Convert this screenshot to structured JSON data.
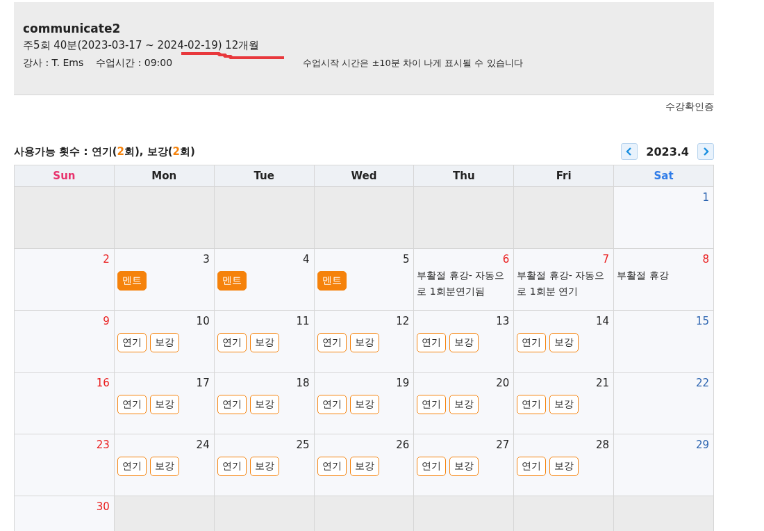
{
  "course": {
    "title": "communicate2",
    "schedule": "주5회 40분(2023-03-17 ~ 2024-02-19) 12개월",
    "teacher": "강사 : T. Ems",
    "time": "수업시간 : 09:00",
    "notice": "수업시작 시간은 ±10분 차이 나게 표시될 수 있습니다"
  },
  "certificate_link": "수강확인증",
  "usage": "사용가능 횟수 : 연기(**2**회), 보강(**2**회)",
  "month": "2023.4",
  "weekdays": [
    {
      "label": "Sun",
      "color": "#e8336d"
    },
    {
      "label": "Mon",
      "color": "#222222"
    },
    {
      "label": "Tue",
      "color": "#222222"
    },
    {
      "label": "Wed",
      "color": "#222222"
    },
    {
      "label": "Thu",
      "color": "#222222"
    },
    {
      "label": "Fri",
      "color": "#222222"
    },
    {
      "label": "Sat",
      "color": "#2f7ce8"
    }
  ],
  "weeks": [
    [
      {
        "kind": "blank"
      },
      {
        "kind": "blank"
      },
      {
        "kind": "blank"
      },
      {
        "kind": "blank"
      },
      {
        "kind": "blank"
      },
      {
        "kind": "blank"
      },
      {
        "kind": "day",
        "day": "1",
        "color": "#2c64b0"
      }
    ],
    [
      {
        "kind": "day",
        "day": "2",
        "color": "#ea1c1c"
      },
      {
        "kind": "day",
        "day": "3",
        "color": "#222222",
        "items": [
          {
            "kind": "filled",
            "text": "멘트"
          }
        ]
      },
      {
        "kind": "day",
        "day": "4",
        "color": "#222222",
        "items": [
          {
            "kind": "filled",
            "text": "멘트"
          }
        ]
      },
      {
        "kind": "day",
        "day": "5",
        "color": "#222222",
        "items": [
          {
            "kind": "filled",
            "text": "멘트"
          }
        ]
      },
      {
        "kind": "day",
        "day": "6",
        "color": "#ea1c1c",
        "items": [
          {
            "kind": "note",
            "text": "부활절 휴강- 자동으로 1회분연기됨"
          }
        ]
      },
      {
        "kind": "day",
        "day": "7",
        "color": "#ea1c1c",
        "items": [
          {
            "kind": "note",
            "text": "부활절 휴강- 자동으로 1회분 연기"
          }
        ]
      },
      {
        "kind": "day",
        "day": "8",
        "color": "#ea1c1c",
        "items": [
          {
            "kind": "note",
            "text": "부활절 휴강"
          }
        ]
      }
    ],
    [
      {
        "kind": "day",
        "day": "9",
        "color": "#ea1c1c"
      },
      {
        "kind": "day",
        "day": "10",
        "color": "#222222",
        "items": [
          {
            "kind": "outline",
            "text": "연기"
          },
          {
            "kind": "outline",
            "text": "보강"
          }
        ]
      },
      {
        "kind": "day",
        "day": "11",
        "color": "#222222",
        "items": [
          {
            "kind": "outline",
            "text": "연기"
          },
          {
            "kind": "outline",
            "text": "보강"
          }
        ]
      },
      {
        "kind": "day",
        "day": "12",
        "color": "#222222",
        "items": [
          {
            "kind": "outline",
            "text": "연기"
          },
          {
            "kind": "outline",
            "text": "보강"
          }
        ]
      },
      {
        "kind": "day",
        "day": "13",
        "color": "#222222",
        "items": [
          {
            "kind": "outline",
            "text": "연기"
          },
          {
            "kind": "outline",
            "text": "보강"
          }
        ]
      },
      {
        "kind": "day",
        "day": "14",
        "color": "#222222",
        "items": [
          {
            "kind": "outline",
            "text": "연기"
          },
          {
            "kind": "outline",
            "text": "보강"
          }
        ]
      },
      {
        "kind": "day",
        "day": "15",
        "color": "#2c64b0"
      }
    ],
    [
      {
        "kind": "day",
        "day": "16",
        "color": "#ea1c1c"
      },
      {
        "kind": "day",
        "day": "17",
        "color": "#222222",
        "items": [
          {
            "kind": "outline",
            "text": "연기"
          },
          {
            "kind": "outline",
            "text": "보강"
          }
        ]
      },
      {
        "kind": "day",
        "day": "18",
        "color": "#222222",
        "items": [
          {
            "kind": "outline",
            "text": "연기"
          },
          {
            "kind": "outline",
            "text": "보강"
          }
        ]
      },
      {
        "kind": "day",
        "day": "19",
        "color": "#222222",
        "items": [
          {
            "kind": "outline",
            "text": "연기"
          },
          {
            "kind": "outline",
            "text": "보강"
          }
        ]
      },
      {
        "kind": "day",
        "day": "20",
        "color": "#222222",
        "items": [
          {
            "kind": "outline",
            "text": "연기"
          },
          {
            "kind": "outline",
            "text": "보강"
          }
        ]
      },
      {
        "kind": "day",
        "day": "21",
        "color": "#222222",
        "items": [
          {
            "kind": "outline",
            "text": "연기"
          },
          {
            "kind": "outline",
            "text": "보강"
          }
        ]
      },
      {
        "kind": "day",
        "day": "22",
        "color": "#2c64b0"
      }
    ],
    [
      {
        "kind": "day",
        "day": "23",
        "color": "#ea1c1c"
      },
      {
        "kind": "day",
        "day": "24",
        "color": "#222222",
        "items": [
          {
            "kind": "outline",
            "text": "연기"
          },
          {
            "kind": "outline",
            "text": "보강"
          }
        ]
      },
      {
        "kind": "day",
        "day": "25",
        "color": "#222222",
        "items": [
          {
            "kind": "outline",
            "text": "연기"
          },
          {
            "kind": "outline",
            "text": "보강"
          }
        ]
      },
      {
        "kind": "day",
        "day": "26",
        "color": "#222222",
        "items": [
          {
            "kind": "outline",
            "text": "연기"
          },
          {
            "kind": "outline",
            "text": "보강"
          }
        ]
      },
      {
        "kind": "day",
        "day": "27",
        "color": "#222222",
        "items": [
          {
            "kind": "outline",
            "text": "연기"
          },
          {
            "kind": "outline",
            "text": "보강"
          }
        ]
      },
      {
        "kind": "day",
        "day": "28",
        "color": "#222222",
        "items": [
          {
            "kind": "outline",
            "text": "연기"
          },
          {
            "kind": "outline",
            "text": "보강"
          }
        ]
      },
      {
        "kind": "day",
        "day": "29",
        "color": "#2c64b0"
      }
    ],
    [
      {
        "kind": "day",
        "day": "30",
        "color": "#ea1c1c"
      },
      {
        "kind": "blank"
      },
      {
        "kind": "blank"
      },
      {
        "kind": "blank"
      },
      {
        "kind": "blank"
      },
      {
        "kind": "blank"
      },
      {
        "kind": "blank"
      }
    ]
  ]
}
